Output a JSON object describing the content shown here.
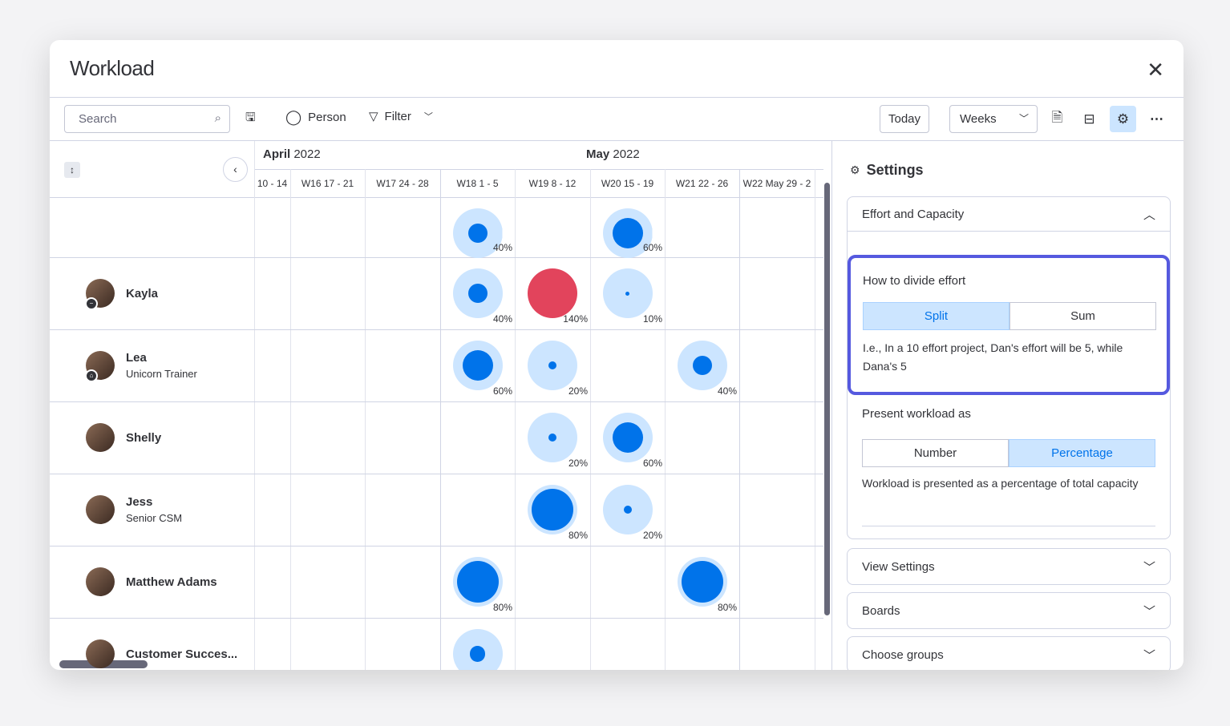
{
  "window": {
    "title": "Workload"
  },
  "toolbar": {
    "search_placeholder": "Search",
    "person": "Person",
    "filter": "Filter",
    "today": "Today",
    "view": "Weeks"
  },
  "timeline": {
    "months": [
      {
        "bold": "April",
        "year": " 2022"
      },
      {
        "bold": "May",
        "year": " 2022"
      }
    ],
    "weeks": [
      "10 - 14",
      "W16  17 - 21",
      "W17  24 - 28",
      "W18  1 - 5",
      "W19  8 - 12",
      "W20  15 - 19",
      "W21  22 - 26",
      "W22  May 29 - 2"
    ]
  },
  "partial_row": {
    "cells": [
      {
        "week": "W18",
        "pct": 40
      },
      {
        "week": "W20",
        "pct": 60
      }
    ]
  },
  "people": [
    {
      "name": "Kayla",
      "role": "",
      "badge": "minus",
      "cells": [
        {
          "week": "W18",
          "pct": 40
        },
        {
          "week": "W19",
          "pct": 140
        },
        {
          "week": "W20",
          "pct": 10
        }
      ]
    },
    {
      "name": "Lea",
      "role": "Unicorn Trainer",
      "badge": "home",
      "cells": [
        {
          "week": "W18",
          "pct": 60
        },
        {
          "week": "W19",
          "pct": 20
        },
        {
          "week": "W21",
          "pct": 40
        }
      ]
    },
    {
      "name": "Shelly",
      "role": "",
      "badge": "",
      "cells": [
        {
          "week": "W19",
          "pct": 20
        },
        {
          "week": "W20",
          "pct": 60
        }
      ]
    },
    {
      "name": "Jess",
      "role": "Senior CSM",
      "badge": "",
      "cells": [
        {
          "week": "W19",
          "pct": 80
        },
        {
          "week": "W20",
          "pct": 20
        }
      ]
    },
    {
      "name": "Matthew Adams",
      "role": "",
      "badge": "",
      "cells": [
        {
          "week": "W18",
          "pct": 80
        },
        {
          "week": "W21",
          "pct": 80
        }
      ]
    },
    {
      "name": "Customer Succes...",
      "role": "",
      "badge": "",
      "cells": [
        {
          "week": "W18",
          "pct": 33
        }
      ]
    }
  ],
  "colors": {
    "accent": "#0073ea",
    "light": "#cce5ff",
    "over": "#e2445c",
    "highlight": "#5559df"
  },
  "settings": {
    "title": "Settings",
    "effort_section": "Effort and Capacity",
    "divide_label": "How to divide effort",
    "divide_options": [
      "Split",
      "Sum"
    ],
    "divide_selected": "Split",
    "divide_help": "I.e., In a 10 effort project, Dan's effort will be 5, while Dana's 5",
    "present_label": "Present workload as",
    "present_options": [
      "Number",
      "Percentage"
    ],
    "present_selected": "Percentage",
    "present_help": "Workload is presented as a percentage of total capacity",
    "sections": [
      "View Settings",
      "Boards",
      "Choose groups"
    ]
  }
}
